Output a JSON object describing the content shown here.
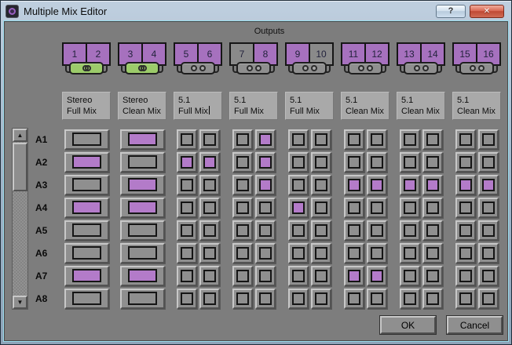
{
  "window": {
    "title": "Multiple Mix Editor",
    "help_glyph": "?",
    "close_glyph": "✕"
  },
  "icons": {
    "app_icon": "avid-media-composer-icon",
    "scroll_up": "▲",
    "scroll_down": "▼",
    "linked": "overlapping-circles",
    "unlinked": "separate-circles"
  },
  "outputs": {
    "header": "Outputs",
    "pairs": [
      {
        "channels": [
          {
            "label": "1",
            "active": true
          },
          {
            "label": "2",
            "active": true
          }
        ],
        "linked": true
      },
      {
        "channels": [
          {
            "label": "3",
            "active": true
          },
          {
            "label": "4",
            "active": true
          }
        ],
        "linked": true
      },
      {
        "channels": [
          {
            "label": "5",
            "active": true
          },
          {
            "label": "6",
            "active": true
          }
        ],
        "linked": false
      },
      {
        "channels": [
          {
            "label": "7",
            "active": false
          },
          {
            "label": "8",
            "active": true
          }
        ],
        "linked": false
      },
      {
        "channels": [
          {
            "label": "9",
            "active": true
          },
          {
            "label": "10",
            "active": false
          }
        ],
        "linked": false
      },
      {
        "channels": [
          {
            "label": "11",
            "active": true
          },
          {
            "label": "12",
            "active": true
          }
        ],
        "linked": false
      },
      {
        "channels": [
          {
            "label": "13",
            "active": true
          },
          {
            "label": "14",
            "active": true
          }
        ],
        "linked": false
      },
      {
        "channels": [
          {
            "label": "15",
            "active": true
          },
          {
            "label": "16",
            "active": true
          }
        ],
        "linked": false
      }
    ]
  },
  "mixes": [
    {
      "line1": "Stereo",
      "line2": "Full Mix",
      "focused": false
    },
    {
      "line1": "Stereo",
      "line2": "Clean Mix",
      "focused": false
    },
    {
      "line1": "5.1",
      "line2": "Full Mix",
      "focused": true
    },
    {
      "line1": "5.1",
      "line2": "Full Mix",
      "focused": false
    },
    {
      "line1": "5.1",
      "line2": "Full Mix",
      "focused": false
    },
    {
      "line1": "5.1",
      "line2": "Clean Mix",
      "focused": false
    },
    {
      "line1": "5.1",
      "line2": "Clean Mix",
      "focused": false
    },
    {
      "line1": "5.1",
      "line2": "Clean Mix",
      "focused": false
    }
  ],
  "tracks": [
    {
      "label": "A1",
      "cells": [
        [
          0
        ],
        [
          1
        ],
        [
          0,
          0
        ],
        [
          0,
          1
        ],
        [
          0,
          0
        ],
        [
          0,
          0
        ],
        [
          0,
          0
        ],
        [
          0,
          0
        ]
      ]
    },
    {
      "label": "A2",
      "cells": [
        [
          1
        ],
        [
          0
        ],
        [
          1,
          1
        ],
        [
          0,
          1
        ],
        [
          0,
          0
        ],
        [
          0,
          0
        ],
        [
          0,
          0
        ],
        [
          0,
          0
        ]
      ]
    },
    {
      "label": "A3",
      "cells": [
        [
          0
        ],
        [
          1
        ],
        [
          0,
          0
        ],
        [
          0,
          1
        ],
        [
          0,
          0
        ],
        [
          1,
          1
        ],
        [
          1,
          1
        ],
        [
          1,
          1
        ]
      ]
    },
    {
      "label": "A4",
      "cells": [
        [
          1
        ],
        [
          1
        ],
        [
          0,
          0
        ],
        [
          0,
          0
        ],
        [
          1,
          0
        ],
        [
          0,
          0
        ],
        [
          0,
          0
        ],
        [
          0,
          0
        ]
      ]
    },
    {
      "label": "A5",
      "cells": [
        [
          0
        ],
        [
          0
        ],
        [
          0,
          0
        ],
        [
          0,
          0
        ],
        [
          0,
          0
        ],
        [
          0,
          0
        ],
        [
          0,
          0
        ],
        [
          0,
          0
        ]
      ]
    },
    {
      "label": "A6",
      "cells": [
        [
          0
        ],
        [
          0
        ],
        [
          0,
          0
        ],
        [
          0,
          0
        ],
        [
          0,
          0
        ],
        [
          0,
          0
        ],
        [
          0,
          0
        ],
        [
          0,
          0
        ]
      ]
    },
    {
      "label": "A7",
      "cells": [
        [
          1
        ],
        [
          1
        ],
        [
          0,
          0
        ],
        [
          0,
          0
        ],
        [
          0,
          0
        ],
        [
          1,
          1
        ],
        [
          0,
          0
        ],
        [
          0,
          0
        ]
      ]
    },
    {
      "label": "A8",
      "cells": [
        [
          0
        ],
        [
          0
        ],
        [
          0,
          0
        ],
        [
          0,
          0
        ],
        [
          0,
          0
        ],
        [
          0,
          0
        ],
        [
          0,
          0
        ],
        [
          0,
          0
        ]
      ]
    }
  ],
  "buttons": {
    "ok": "OK",
    "cancel": "Cancel"
  },
  "colors": {
    "selected_assign": "#b37bc9",
    "active_channel": "#a671be",
    "link_active": "#9ccb6a",
    "panel_background": "#7d7d7d"
  }
}
